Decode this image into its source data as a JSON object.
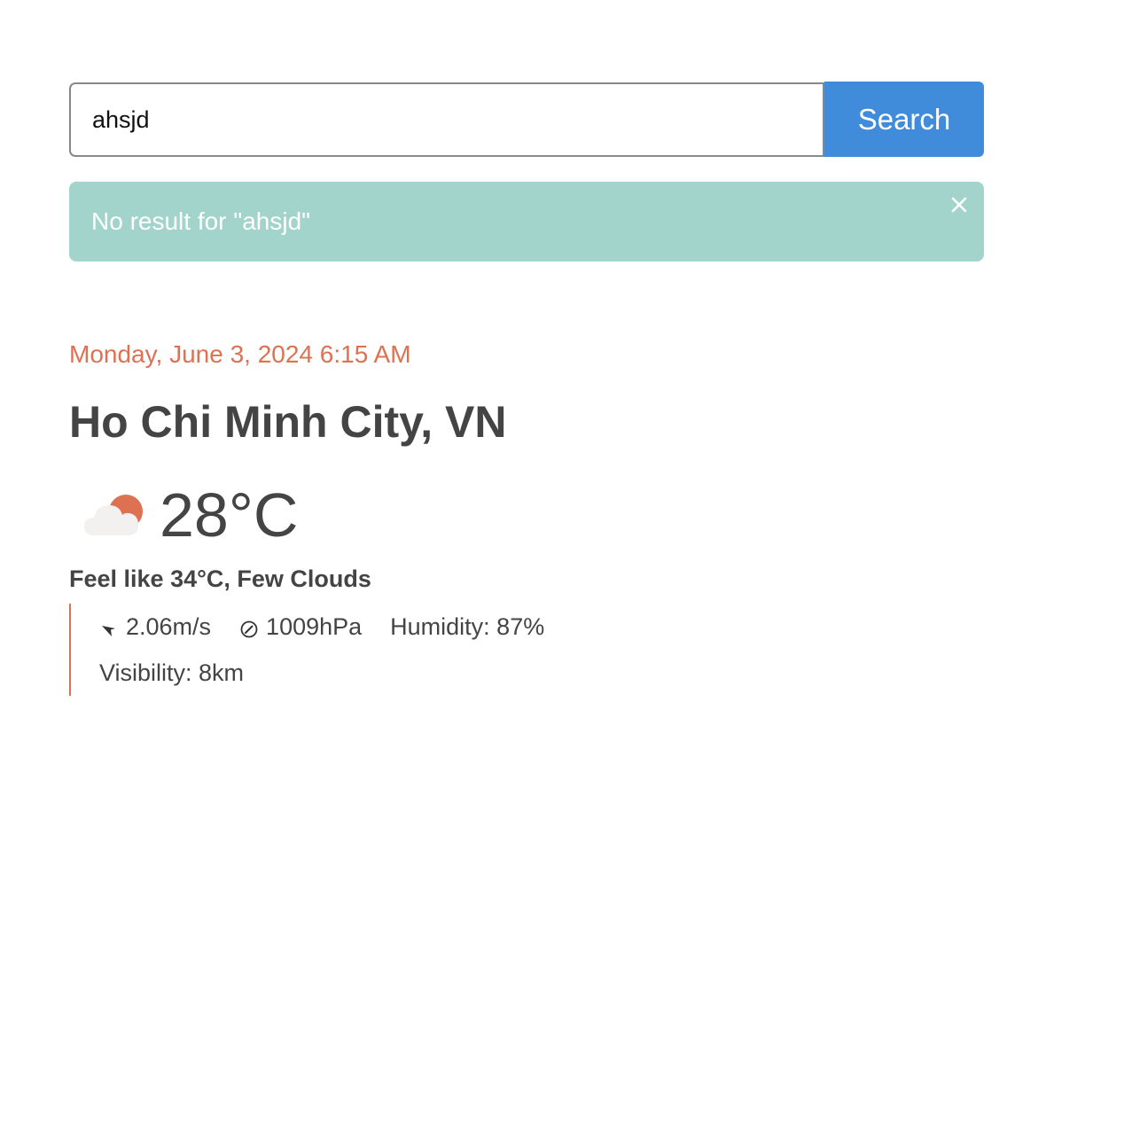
{
  "search": {
    "value": "ahsjd",
    "button_label": "Search"
  },
  "alert": {
    "message": "No result for \"ahsjd\"",
    "close_icon": "close-icon"
  },
  "weather": {
    "datetime": "Monday, June 3, 2024 6:15 AM",
    "location": "Ho Chi Minh City, VN",
    "icon": "partly-cloudy-day-icon",
    "temperature": "28°C",
    "feels_like": "Feel like 34°C, Few Clouds",
    "wind": "2.06m/s",
    "pressure": "1009hPa",
    "humidity": "Humidity: 87%",
    "visibility": "Visibility: 8km"
  },
  "colors": {
    "button": "#418cda",
    "alert_bg": "#a3d4cc",
    "accent": "#de7152",
    "text": "#444444"
  }
}
